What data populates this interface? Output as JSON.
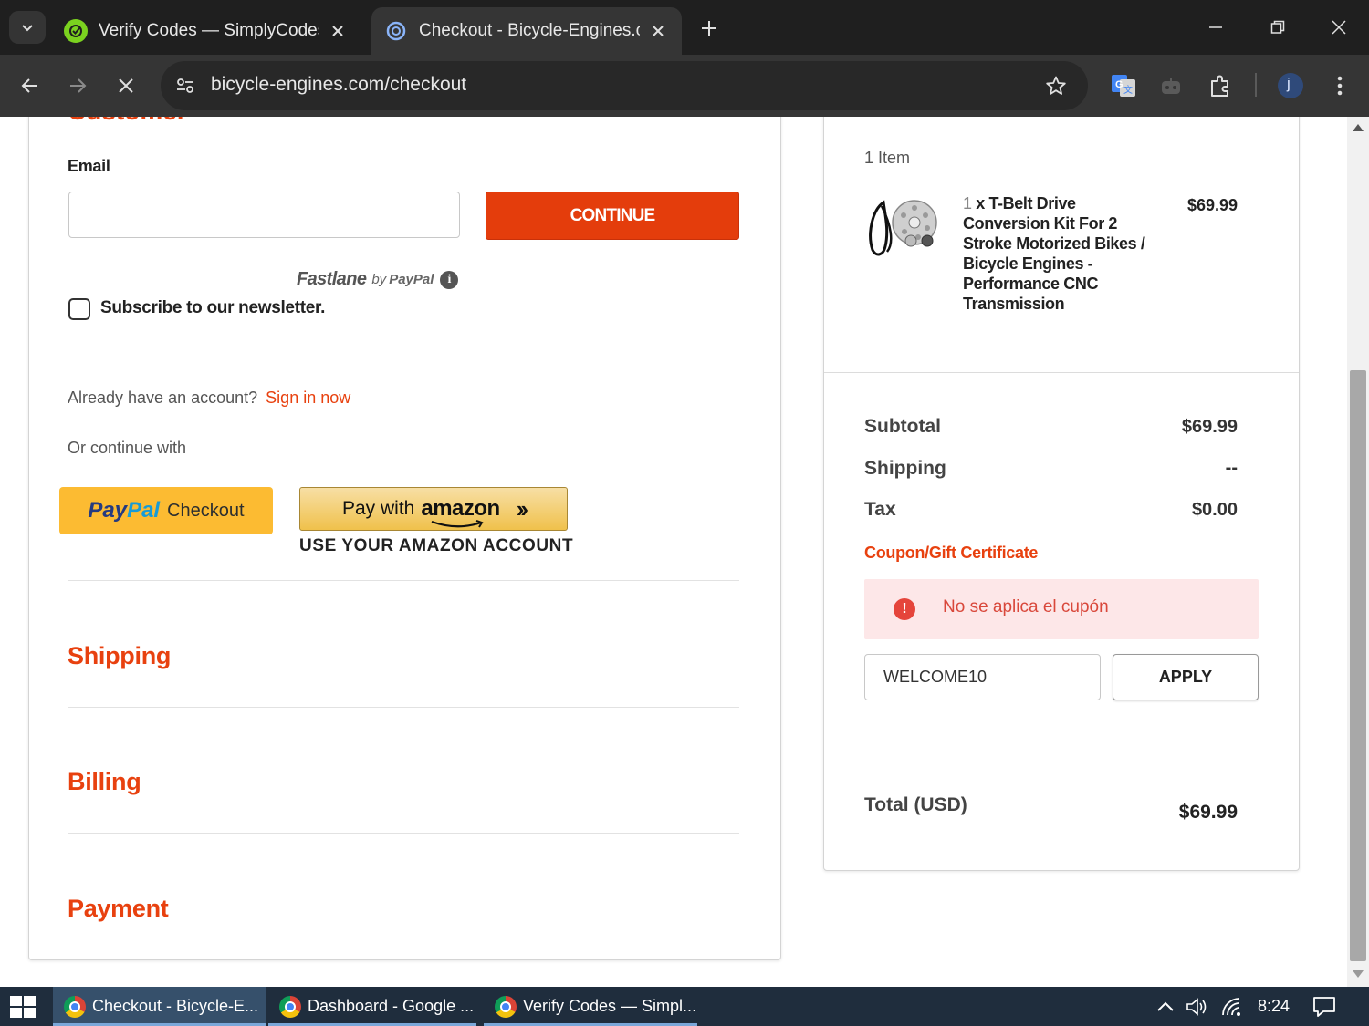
{
  "browser": {
    "tabs": [
      {
        "title": "Verify Codes — SimplyCodes",
        "active": false
      },
      {
        "title": "Checkout - Bicycle-Engines.com",
        "active": true
      }
    ],
    "url": "bicycle-engines.com/checkout",
    "profile_initial": "j"
  },
  "customer": {
    "heading": "Customer",
    "email_label": "Email",
    "email_value": "",
    "continue_label": "CONTINUE",
    "fastlane_name": "Fastlane",
    "fastlane_by": "by",
    "fastlane_paypal": "PayPal",
    "newsletter_label": "Subscribe to our newsletter.",
    "newsletter_checked": false,
    "account_prompt": "Already have an account?",
    "sign_in_label": "Sign in now",
    "or_continue": "Or continue with",
    "paypal": {
      "pay": "Pay",
      "pal": "Pal",
      "checkout": "Checkout"
    },
    "amazon": {
      "pay_with": "Pay with",
      "logo": "amazon",
      "sub_label": "USE YOUR AMAZON ACCOUNT"
    }
  },
  "sections": {
    "shipping": "Shipping",
    "billing": "Billing",
    "payment": "Payment"
  },
  "summary": {
    "item_count": "1 Item",
    "item": {
      "qty": "1",
      "name_rest": " x T-Belt Drive Conversion Kit For 2 Stroke Motorized Bikes / Bicycle Engines - Performance CNC Transmission",
      "price": "$69.99"
    },
    "subtotal_label": "Subtotal",
    "subtotal_value": "$69.99",
    "shipping_label": "Shipping",
    "shipping_value": "--",
    "tax_label": "Tax",
    "tax_value": "$0.00",
    "coupon_label": "Coupon/Gift Certificate",
    "coupon_error": "No se aplica el cupón",
    "coupon_code": "WELCOME10",
    "apply_label": "APPLY",
    "total_label": "Total (USD)",
    "total_value": "$69.99"
  },
  "taskbar": {
    "items": [
      {
        "label": "Checkout - Bicycle-E...",
        "active": true
      },
      {
        "label": "Dashboard - Google ...",
        "active": false
      },
      {
        "label": "Verify Codes — Simpl...",
        "active": false
      }
    ],
    "time": "8:24"
  },
  "colors": {
    "accent": "#e8410f",
    "continue_button": "#e43d0c",
    "paypal_yellow": "#fcbb32",
    "error_bg": "#fde7e8",
    "error_text": "#d9483b"
  }
}
